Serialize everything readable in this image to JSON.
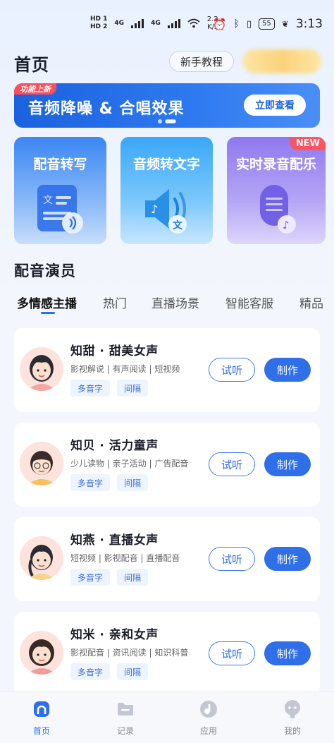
{
  "status_bar": {
    "hd1": "HD 1",
    "hd2": "HD 2",
    "net1": "4G",
    "net2": "4G",
    "speed_value": "2.2",
    "speed_unit": "K/s",
    "battery": "55",
    "time": "3:13"
  },
  "header": {
    "title": "首页",
    "tutorial_label": "新手教程"
  },
  "banner": {
    "tag": "功能上新",
    "title": "音频降噪 & 合唱效果",
    "button": "立即查看"
  },
  "features": [
    {
      "title": "配音转写",
      "badge": ""
    },
    {
      "title": "音频转文字",
      "badge": ""
    },
    {
      "title": "实时录音配乐",
      "badge": "NEW"
    }
  ],
  "section_title": "配音演员",
  "tabs": [
    "多情感主播",
    "热门",
    "直播场景",
    "智能客服",
    "精品"
  ],
  "actors": [
    {
      "name": "知甜 · 甜美女声",
      "desc": "影视解说 | 有声阅读 | 短视频",
      "chips": [
        "多音字",
        "间隔"
      ],
      "listen": "试听",
      "make": "制作"
    },
    {
      "name": "知贝 · 活力童声",
      "desc": "少儿读物 | 亲子活动 | 广告配音",
      "chips": [
        "多音字",
        "间隔"
      ],
      "listen": "试听",
      "make": "制作"
    },
    {
      "name": "知燕 · 直播女声",
      "desc": "短视频 | 影视配音 | 直播配音",
      "chips": [
        "多音字",
        "间隔"
      ],
      "listen": "试听",
      "make": "制作"
    },
    {
      "name": "知米 · 亲和女声",
      "desc": "影视配音 | 资讯阅读 | 知识科普",
      "chips": [
        "多音字",
        "间隔"
      ],
      "listen": "试听",
      "make": "制作"
    }
  ],
  "nav": [
    {
      "label": "首页",
      "active": true
    },
    {
      "label": "记录",
      "active": false
    },
    {
      "label": "应用",
      "active": false
    },
    {
      "label": "我的",
      "active": false
    }
  ],
  "colors": {
    "primary": "#2f6fe8",
    "new_badge": "#ff5360",
    "banner_tag": "#ff4d5a"
  }
}
